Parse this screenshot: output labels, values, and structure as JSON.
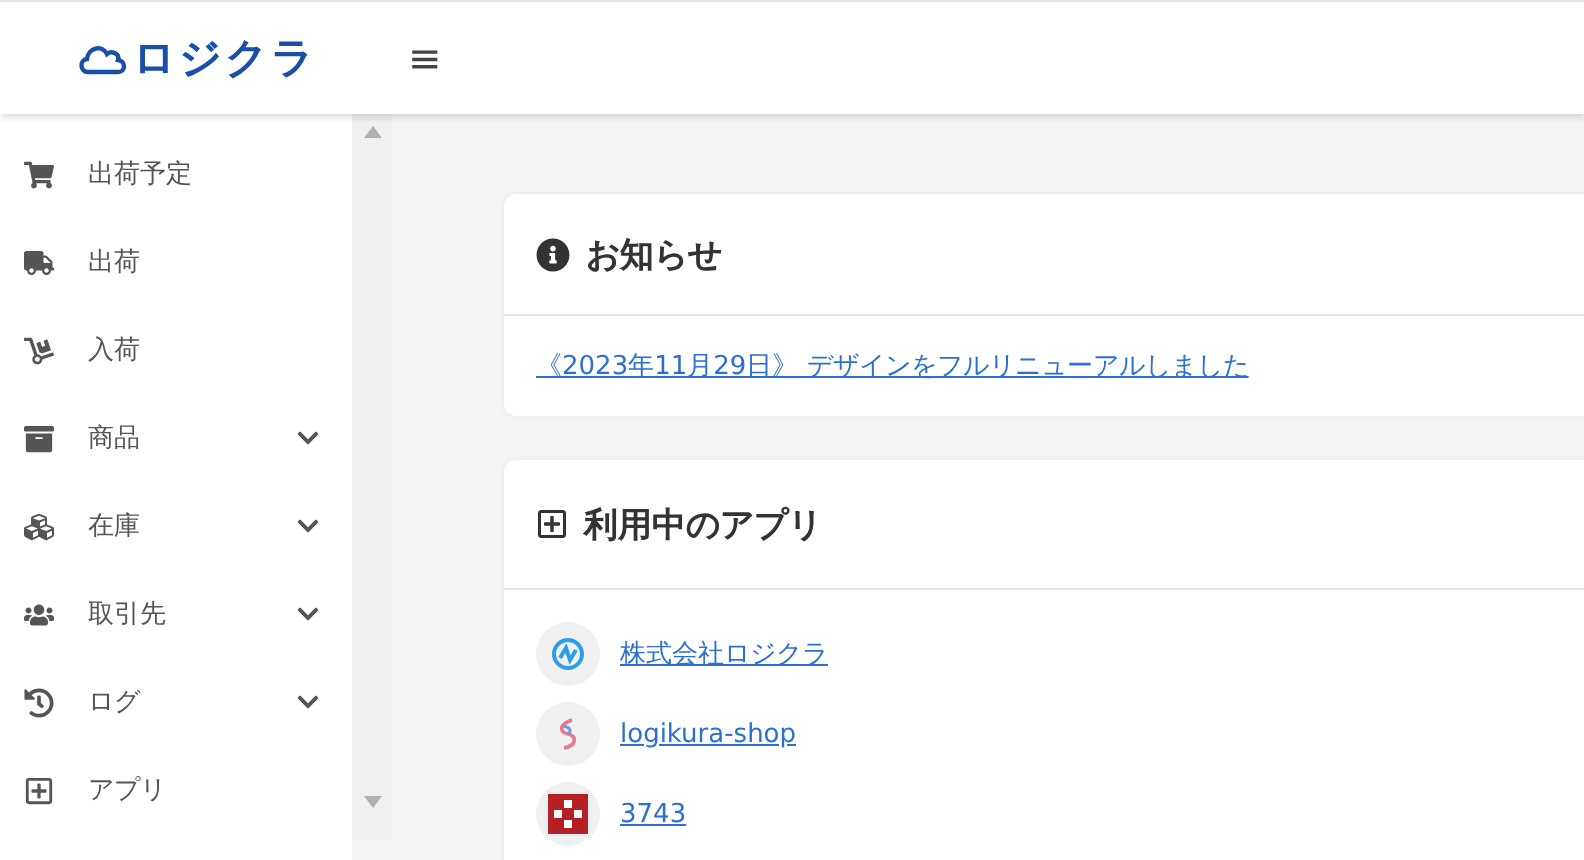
{
  "header": {
    "logo": "ロジクラ",
    "menu_glyph": "≡"
  },
  "sidebar": {
    "items": [
      {
        "label": "出荷予定",
        "kind": "link"
      },
      {
        "label": "出荷",
        "kind": "link"
      },
      {
        "label": "入荷",
        "kind": "link"
      },
      {
        "label": "商品",
        "kind": "group"
      },
      {
        "label": "在庫",
        "kind": "group"
      },
      {
        "label": "取引先",
        "kind": "group"
      },
      {
        "label": "ログ",
        "kind": "group"
      },
      {
        "label": "アプリ",
        "kind": "link"
      }
    ]
  },
  "notice": {
    "title": "お知らせ",
    "link": "《2023年11月29日》 デザインをフルリニューアルしました"
  },
  "apps": {
    "title": "利用中のアプリ",
    "items": [
      {
        "name": "株式会社ロジクラ"
      },
      {
        "name": "logikura-shop"
      },
      {
        "name": "3743"
      }
    ]
  }
}
